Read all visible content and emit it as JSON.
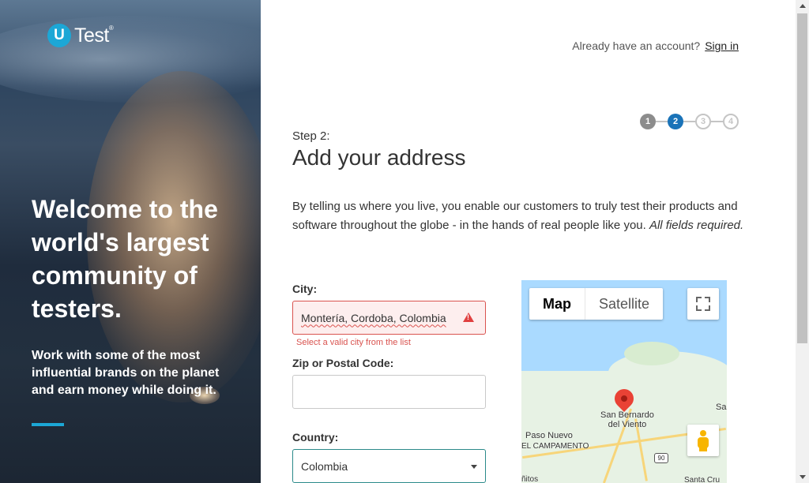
{
  "hero": {
    "logo_letter": "U",
    "logo_text": "Test",
    "logo_mark": "®",
    "title": "Welcome to the world's largest community of testers.",
    "subtitle": "Work with some of the most influential brands on the planet and earn money while doing it.",
    "accent_color": "#1ca7d6"
  },
  "header": {
    "account_prompt": "Already have an account?",
    "signin_label": "Sign in"
  },
  "stepper": {
    "steps": [
      "1",
      "2",
      "3",
      "4"
    ],
    "current": 2
  },
  "form": {
    "step_label": "Step 2:",
    "title": "Add your address",
    "intro_text": "By telling us where you live, you enable our customers to truly test their products and software throughout the globe - in the hands of real people like you.",
    "intro_emphasis": "All fields required.",
    "city": {
      "label": "City:",
      "value": "Montería, Cordoba, Colombia",
      "error": "Select a valid city from the list"
    },
    "zip": {
      "label": "Zip or Postal Code:",
      "value": ""
    },
    "country": {
      "label": "Country:",
      "value": "Colombia"
    }
  },
  "map": {
    "type_options": [
      "Map",
      "Satellite"
    ],
    "selected_type": "Map",
    "labels": {
      "san_bernardo": "San Bernardo\ndel Viento",
      "paso_nuevo": "Paso Nuevo",
      "el_campamento": "EL CAMPAMENTO",
      "sa": "Sa",
      "route": "90",
      "bottom_left": "ñitos",
      "bottom_right": "Santa Cru"
    }
  }
}
